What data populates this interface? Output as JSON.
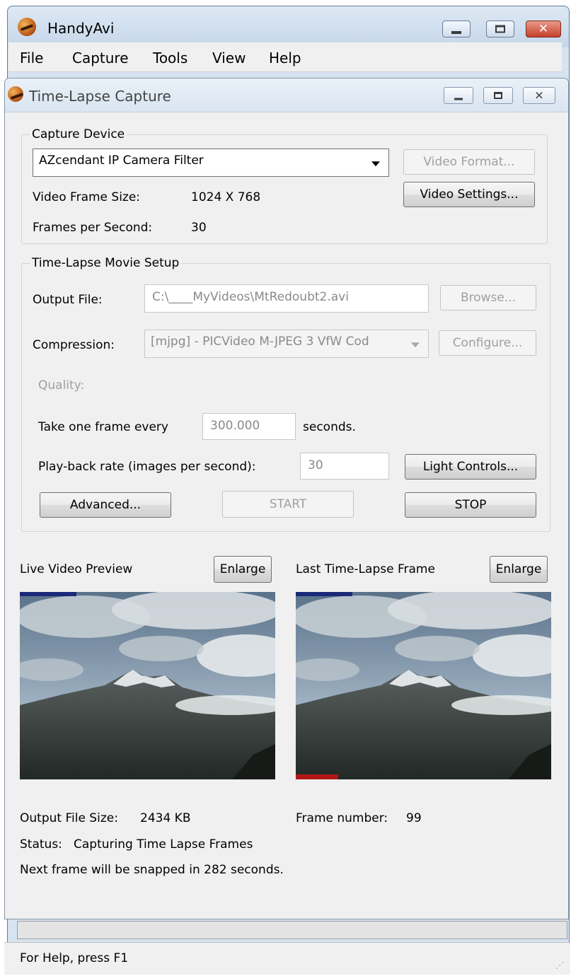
{
  "outer_window": {
    "title": "HandyAvi",
    "menu": [
      "File",
      "Capture",
      "Tools",
      "View",
      "Help"
    ]
  },
  "inner_window": {
    "title": "Time-Lapse Capture"
  },
  "capture_device": {
    "group_label": "Capture Device",
    "device_selected": "AZcendant IP Camera Filter",
    "video_format_button": "Video Format...",
    "video_settings_button": "Video Settings...",
    "frame_size_label": "Video Frame Size:",
    "frame_size_value": "1024 X 768",
    "fps_label": "Frames per Second:",
    "fps_value": "30"
  },
  "movie_setup": {
    "group_label": "Time-Lapse Movie Setup",
    "output_file_label": "Output File:",
    "output_file_value": "C:\\____MyVideos\\MtRedoubt2.avi",
    "browse_button": "Browse...",
    "compression_label": "Compression:",
    "compression_value": "[mjpg] - PICVideo M-JPEG 3 VfW Cod",
    "configure_button": "Configure...",
    "quality_label": "Quality:",
    "take_frame_label": "Take one frame every",
    "take_frame_value": "300.000",
    "seconds_label": "seconds.",
    "playback_label": "Play-back rate (images per second):",
    "playback_value": "30",
    "light_controls_button": "Light Controls...",
    "advanced_button": "Advanced...",
    "start_button": "START",
    "stop_button": "STOP"
  },
  "preview": {
    "live_label": "Live Video Preview",
    "last_label": "Last Time-Lapse Frame",
    "enlarge_label": "Enlarge"
  },
  "status": {
    "output_size_label": "Output File Size:",
    "output_size_value": "2434 KB",
    "frame_number_label": "Frame number:",
    "frame_number_value": "99",
    "status_label": "Status:",
    "status_value": "Capturing Time Lapse Frames",
    "next_frame_text": "Next frame will be snapped in 282 seconds."
  },
  "statusbar": {
    "help_text": "For Help, press F1"
  },
  "colors": {
    "outer_frame": "#d6e3f1",
    "dialog_face": "#f0f0f0",
    "close_button": "#c4412a"
  },
  "icons": [
    "app-icon",
    "minimize-icon",
    "maximize-icon",
    "close-icon",
    "chevron-down-icon"
  ]
}
